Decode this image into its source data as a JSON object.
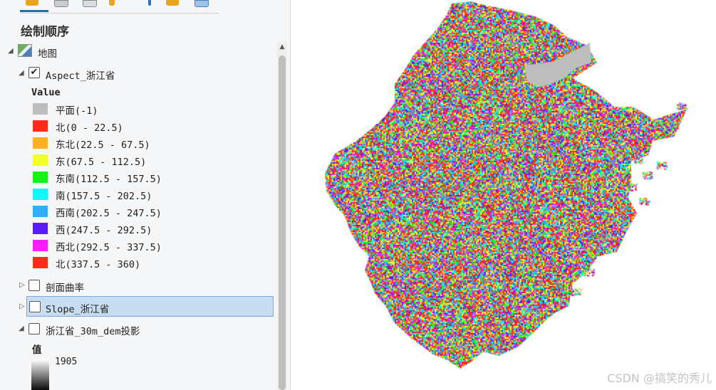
{
  "pane": {
    "title": "绘制顺序"
  },
  "toolbar": {
    "icons": [
      "list-by-drawing-order-icon",
      "list-by-source-icon",
      "list-by-selection-icon",
      "list-by-editing-icon",
      "list-by-snapping-icon",
      "list-by-labeling-icon",
      "list-by-perspective-imagery-icon"
    ]
  },
  "tree": {
    "map_label": "地图",
    "aspect_layer": {
      "name": "Aspect_浙江省",
      "checked": true,
      "legend_heading": "Value",
      "classes": [
        {
          "label": "平面(-1)",
          "color": "#bdbdbd"
        },
        {
          "label": "北(0 - 22.5)",
          "color": "#ff2a1a"
        },
        {
          "label": "东北(22.5 - 67.5)",
          "color": "#ffb21f"
        },
        {
          "label": "东(67.5 - 112.5)",
          "color": "#f1ff2c"
        },
        {
          "label": "东南(112.5 - 157.5)",
          "color": "#12f31c"
        },
        {
          "label": "南(157.5 - 202.5)",
          "color": "#12f5f9"
        },
        {
          "label": "西南(202.5 - 247.5)",
          "color": "#33aef6"
        },
        {
          "label": "西(247.5 - 292.5)",
          "color": "#5a1cf6"
        },
        {
          "label": "西北(292.5 - 337.5)",
          "color": "#f71ef8"
        },
        {
          "label": "北(337.5 - 360)",
          "color": "#ff2a1a"
        }
      ]
    },
    "layers": [
      {
        "name": "剖面曲率",
        "checked": false
      },
      {
        "name": "Slope_浙江省",
        "checked": false
      },
      {
        "name": "浙江省_30m_dem投影",
        "checked": false
      }
    ],
    "dem_legend_heading": "值",
    "dem_max_value": "1905"
  },
  "map": {
    "watermark": "CSDN @搞笑的秀儿"
  }
}
